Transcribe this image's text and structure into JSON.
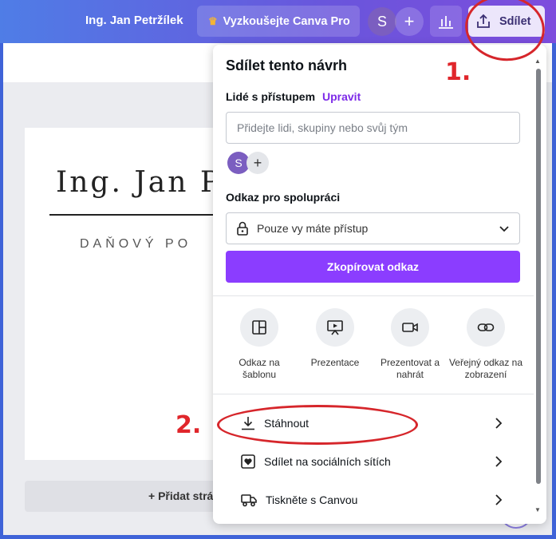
{
  "topbar": {
    "user_name": "Ing. Jan Petržílek",
    "try_pro_label": "Vyzkoušejte Canva Pro",
    "avatar_initial": "S",
    "share_label": "Sdílet",
    "icons": [
      "crown-icon",
      "plus-icon",
      "stats-icon",
      "upload-icon"
    ]
  },
  "canvas": {
    "design_name": "Ing. Jan Pe",
    "design_subtitle": "DAŇOVÝ PO",
    "add_page_label": "+ Přidat strá"
  },
  "share_panel": {
    "title": "Sdílet tento návrh",
    "people_label": "Lidé s přístupem",
    "edit_link": "Upravit",
    "people_placeholder": "Přidejte lidi, skupiny nebo svůj tým",
    "avatar_initial": "S",
    "link_label": "Odkaz pro spolupráci",
    "access_value": "Pouze vy máte přístup",
    "copy_button": "Zkopírovat odkaz",
    "options": [
      {
        "label": "Odkaz na šablonu",
        "icon": "template-icon"
      },
      {
        "label": "Prezentace",
        "icon": "presentation-icon"
      },
      {
        "label": "Prezentovat a nahrát",
        "icon": "video-camera-icon"
      },
      {
        "label": "Veřejný odkaz na zobrazení",
        "icon": "link-icon"
      }
    ],
    "menu": [
      {
        "label": "Stáhnout",
        "icon": "download-icon"
      },
      {
        "label": "Sdílet na sociálních sítích",
        "icon": "heart-icon"
      },
      {
        "label": "Tiskněte s Canvou",
        "icon": "truck-icon"
      }
    ]
  },
  "annotations": {
    "step1": "1.",
    "step2": "2.",
    "color": "#e0262b"
  },
  "colors": {
    "accent": "#8b3dff",
    "link": "#7d2ae8",
    "topbar_start": "#4f7de6",
    "topbar_end": "#7d4ddd"
  }
}
